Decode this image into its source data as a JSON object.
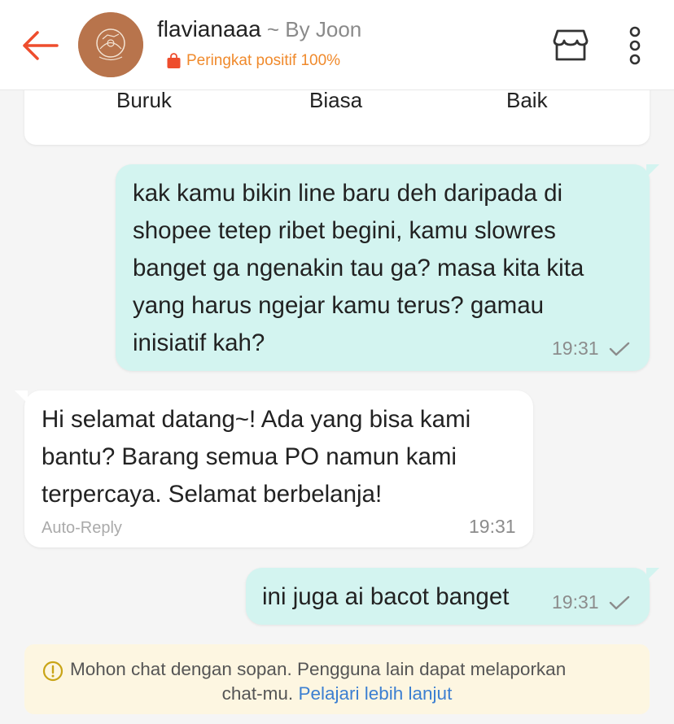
{
  "header": {
    "shop_name": "flavianaaa",
    "shop_suffix": " ~ By Joon",
    "rating_text": "Peringkat positif 100%",
    "accent": "#ee4d2d",
    "rating_color": "#f08a2c"
  },
  "rating_card": {
    "options": [
      "Buruk",
      "Biasa",
      "Baik"
    ]
  },
  "messages": [
    {
      "direction": "outgoing",
      "lines": [
        "kak kamu bikin line baru deh daripada di",
        "shopee tetep ribet begini, kamu slowres",
        "banget ga ngenakin tau ga? masa kita kita",
        "yang harus ngejar kamu terus? gamau",
        "inisiatif kah?"
      ],
      "time": "19:31",
      "status_icon": "check-icon"
    },
    {
      "direction": "incoming",
      "lines": [
        "Hi selamat datang~! Ada yang bisa kami",
        "bantu? Barang semua PO namun kami",
        "terpercaya. Selamat berbelanja!"
      ],
      "label": "Auto-Reply",
      "time": "19:31"
    },
    {
      "direction": "outgoing",
      "lines": [
        "ini juga ai bacot banget"
      ],
      "time": "19:31",
      "status_icon": "check-icon"
    }
  ],
  "notice": {
    "text_line1": "Mohon chat dengan sopan. Pengguna lain dapat melaporkan",
    "text_line2": "chat-mu.",
    "link": "Pelajari lebih lanjut",
    "icon": "warning-icon"
  }
}
